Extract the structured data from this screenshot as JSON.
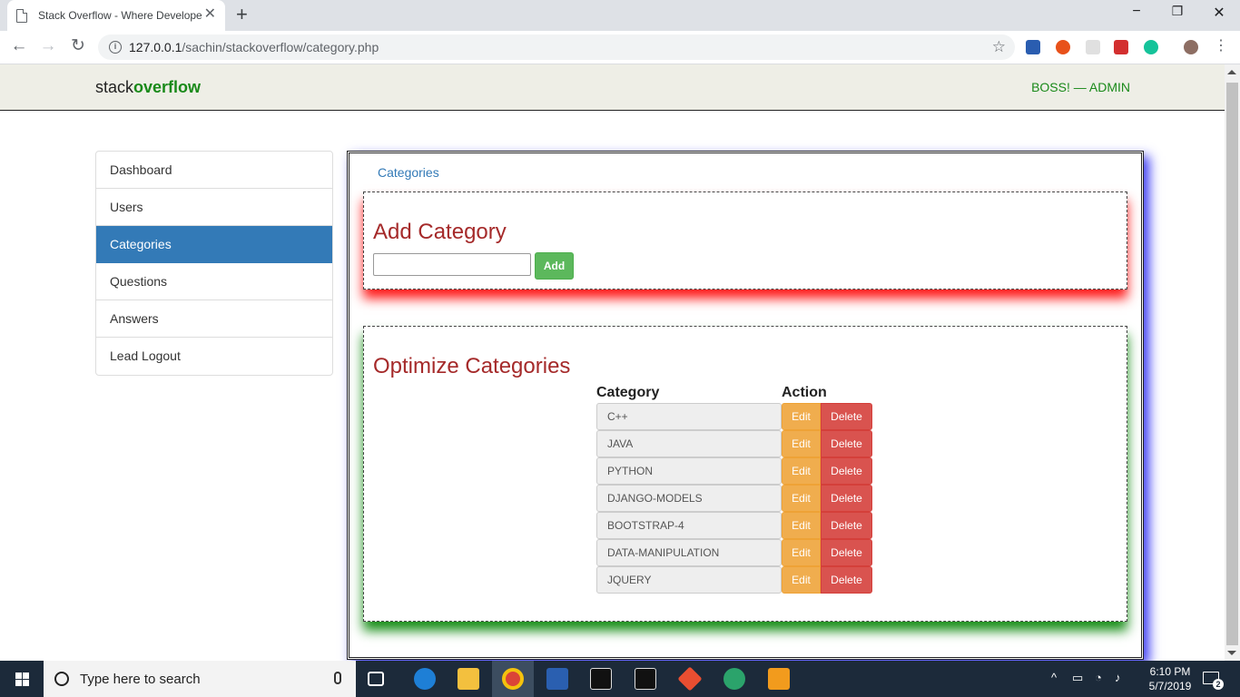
{
  "browser": {
    "tab_title": "Stack Overflow - Where Develope",
    "url_host": "127.0.0.1",
    "url_path": "/sachin/stackoverflow/category.php"
  },
  "navbar": {
    "brand_prefix": "stack",
    "brand_suffix": "overflow",
    "user_label": "BOSS! — ADMIN"
  },
  "sidebar": {
    "items": [
      {
        "label": "Dashboard"
      },
      {
        "label": "Users"
      },
      {
        "label": "Categories",
        "active": true
      },
      {
        "label": "Questions"
      },
      {
        "label": "Answers"
      },
      {
        "label": "Lead Logout"
      }
    ]
  },
  "breadcrumb": "Categories",
  "add_section": {
    "title": "Add Category",
    "input_value": "",
    "button_label": "Add"
  },
  "optimize_section": {
    "title": "Optimize Categories",
    "col_category": "Category",
    "col_action": "Action",
    "edit_label": "Edit",
    "delete_label": "Delete",
    "rows": [
      "C++",
      "JAVA",
      "PYTHON",
      "DJANGO-MODELS",
      "BOOTSTRAP-4",
      "DATA-MANIPULATION",
      "JQUERY"
    ]
  },
  "taskbar": {
    "search_placeholder": "Type here to search",
    "time": "6:10 PM",
    "date": "5/7/2019",
    "notification_count": "2"
  },
  "colors": {
    "brand_green": "#1a8a1a",
    "active_blue": "#337ab7",
    "heading_red": "#a52a2a",
    "btn_success": "#5cb85c",
    "btn_warning": "#f0ad4e",
    "btn_danger": "#d9534f"
  }
}
